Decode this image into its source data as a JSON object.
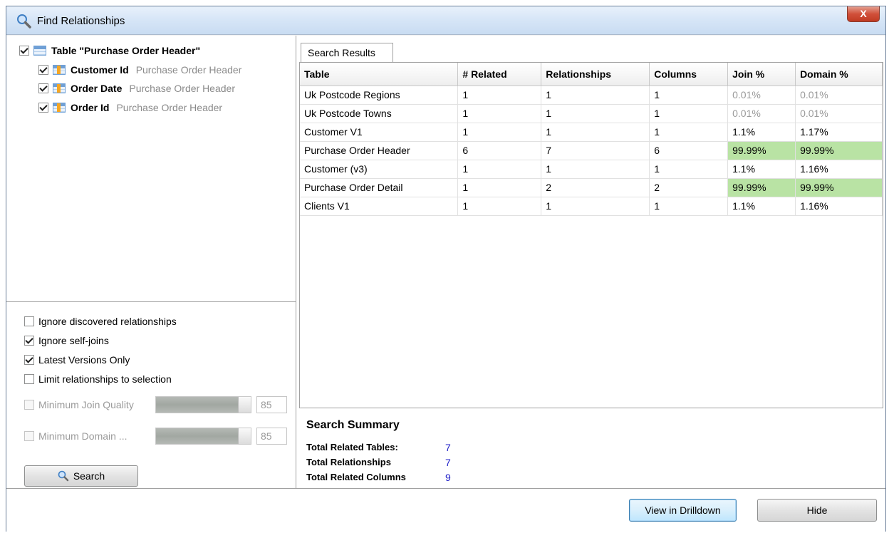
{
  "window": {
    "title": "Find Relationships",
    "close_label": "X"
  },
  "tree": {
    "root": {
      "label": "Table \"Purchase Order Header\"",
      "checked": true
    },
    "children": [
      {
        "label": "Customer Id",
        "sub": "Purchase Order Header",
        "checked": true
      },
      {
        "label": "Order Date",
        "sub": "Purchase Order Header",
        "checked": true
      },
      {
        "label": "Order Id",
        "sub": "Purchase Order Header",
        "checked": true
      }
    ]
  },
  "options": {
    "ignore_discovered": {
      "label": "Ignore discovered relationships",
      "checked": false
    },
    "ignore_self_joins": {
      "label": "Ignore self-joins",
      "checked": true
    },
    "latest_versions": {
      "label": "Latest Versions Only",
      "checked": true
    },
    "limit_selection": {
      "label": "Limit relationships to selection",
      "checked": false
    },
    "min_join_quality": {
      "label": "Minimum Join Quality",
      "value": "85",
      "enabled": false
    },
    "min_domain": {
      "label": "Minimum Domain ...",
      "value": "85",
      "enabled": false
    },
    "search_label": "Search"
  },
  "results": {
    "tab_label": "Search Results",
    "columns": [
      "Table",
      "# Related",
      "Relationships",
      "Columns",
      "Join %",
      "Domain %"
    ],
    "rows": [
      {
        "table": "Uk Postcode Regions",
        "related": "1",
        "relationships": "1",
        "columns": "1",
        "join": "0.01%",
        "domain": "0.01%"
      },
      {
        "table": "Uk Postcode Towns",
        "related": "1",
        "relationships": "1",
        "columns": "1",
        "join": "0.01%",
        "domain": "0.01%"
      },
      {
        "table": "Customer V1",
        "related": "1",
        "relationships": "1",
        "columns": "1",
        "join": "1.1%",
        "domain": "1.17%"
      },
      {
        "table": "Purchase Order Header",
        "related": "6",
        "relationships": "7",
        "columns": "6",
        "join": "99.99%",
        "domain": "99.99%"
      },
      {
        "table": "Customer (v3)",
        "related": "1",
        "relationships": "1",
        "columns": "1",
        "join": "1.1%",
        "domain": "1.16%"
      },
      {
        "table": "Purchase Order Detail",
        "related": "1",
        "relationships": "2",
        "columns": "2",
        "join": "99.99%",
        "domain": "99.99%"
      },
      {
        "table": "Clients V1",
        "related": "1",
        "relationships": "1",
        "columns": "1",
        "join": "1.1%",
        "domain": "1.16%"
      }
    ]
  },
  "summary": {
    "title": "Search Summary",
    "items": [
      {
        "label": "Total Related Tables:",
        "value": "7"
      },
      {
        "label": "Total Relationships",
        "value": "7"
      },
      {
        "label": "Total Related Columns",
        "value": "9"
      }
    ]
  },
  "footer": {
    "drilldown_label": "View in Drilldown",
    "hide_label": "Hide"
  },
  "colors": {
    "highlight_green": "#b9e3a4",
    "summary_value_blue": "#1f1fc8"
  }
}
